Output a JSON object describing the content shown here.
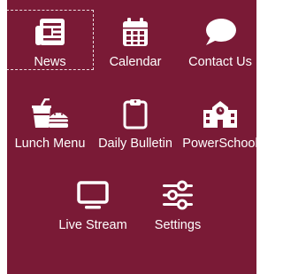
{
  "theme": {
    "background": "#7a1a36",
    "foreground": "#ffffff"
  },
  "menu": {
    "items": [
      {
        "label": "News",
        "icon": "newspaper-icon",
        "focused": true
      },
      {
        "label": "Calendar",
        "icon": "calendar-icon"
      },
      {
        "label": "Contact Us",
        "icon": "chat-bubble-icon"
      },
      {
        "label": "Lunch Menu",
        "icon": "fast-food-icon"
      },
      {
        "label": "Daily Bulletin",
        "icon": "clipboard-icon"
      },
      {
        "label": "PowerSchool",
        "icon": "school-building-icon"
      },
      {
        "label": "Live Stream",
        "icon": "monitor-icon"
      },
      {
        "label": "Settings",
        "icon": "sliders-icon"
      }
    ]
  }
}
